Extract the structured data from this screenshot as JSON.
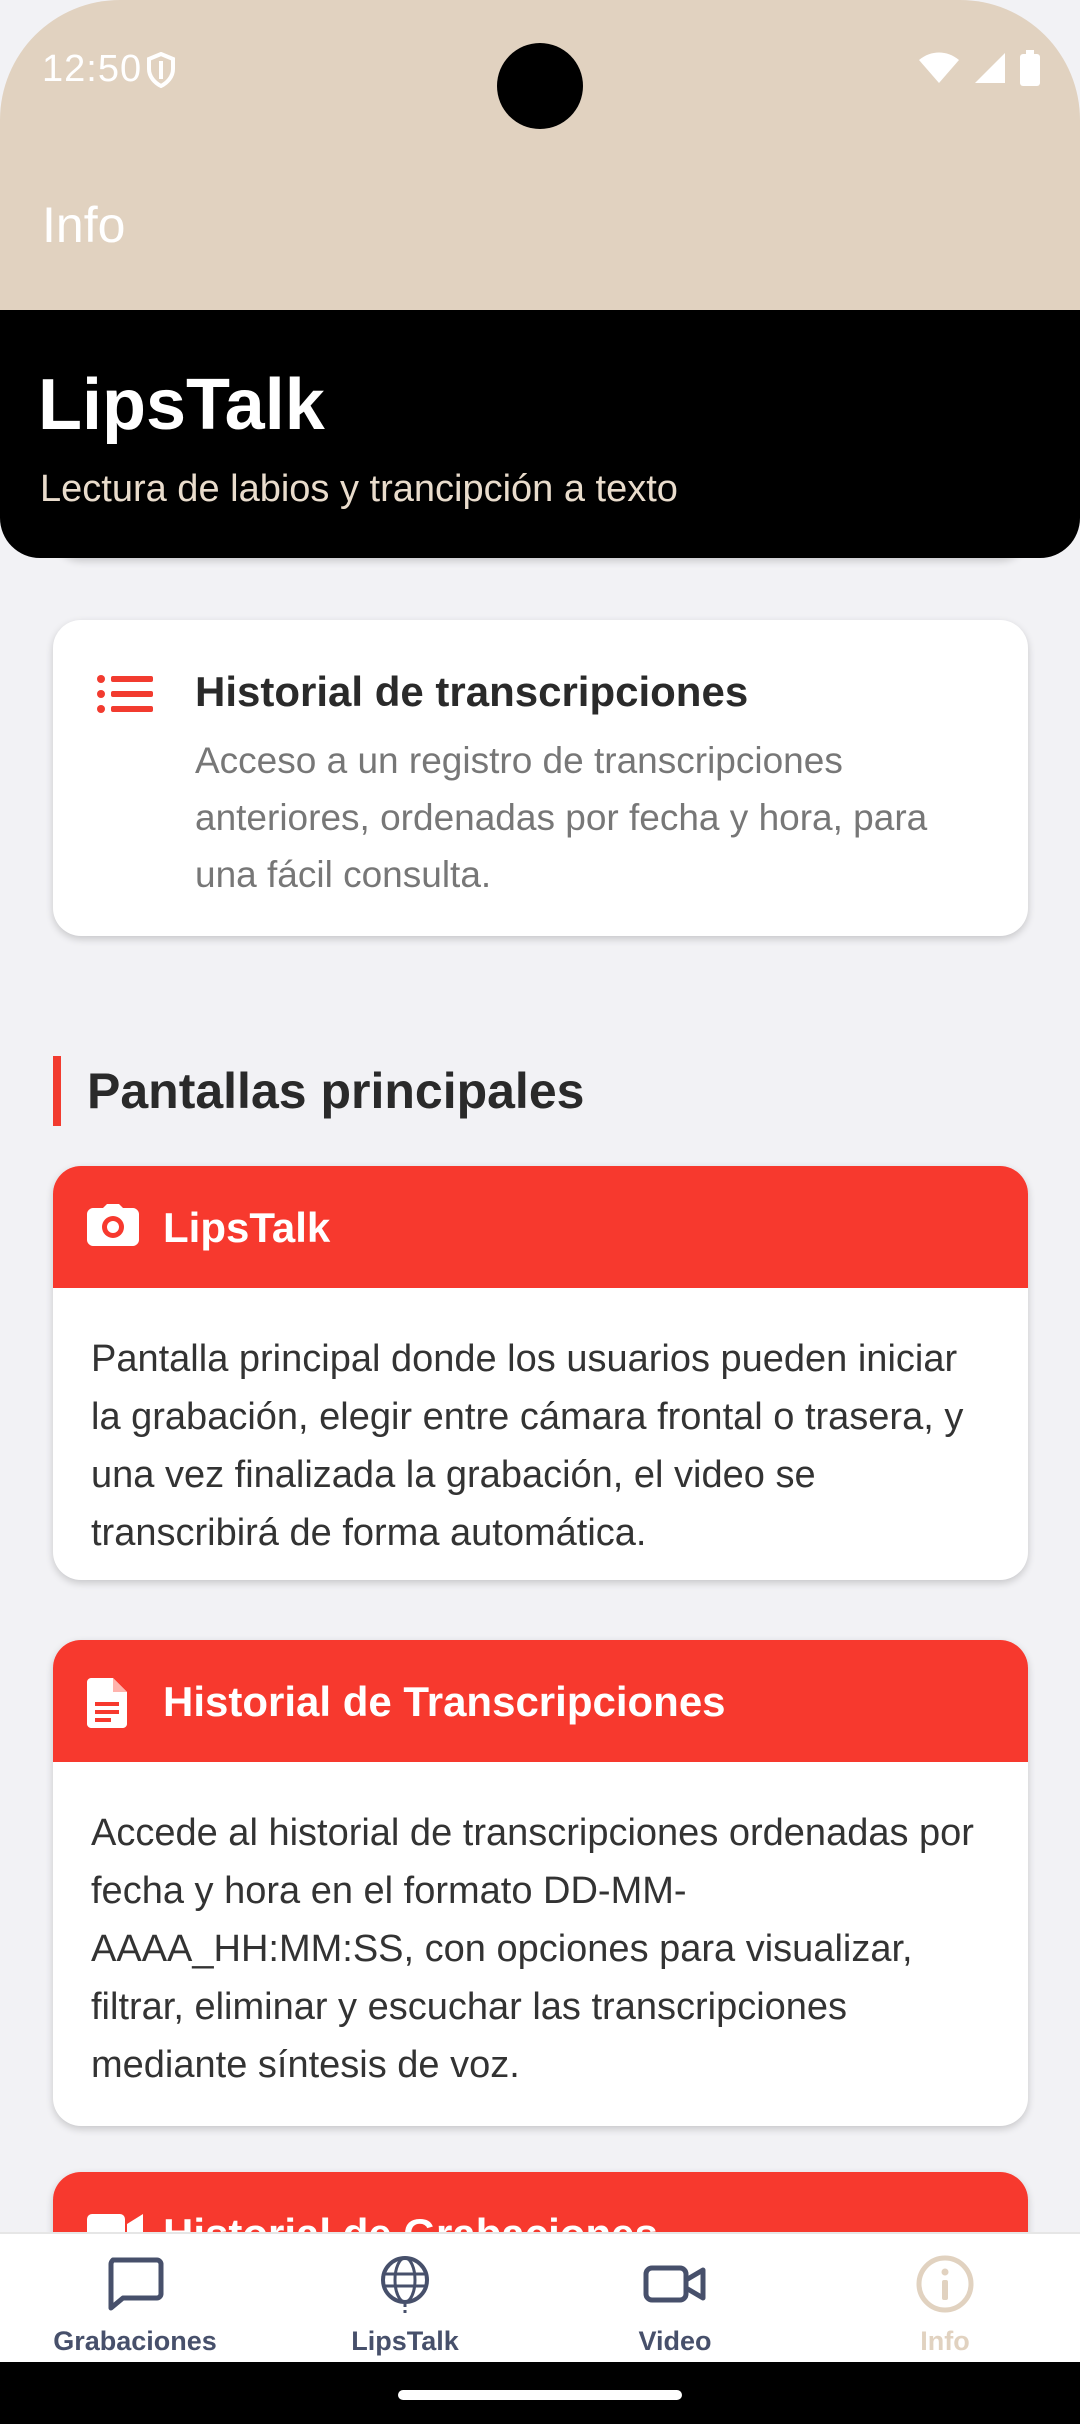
{
  "status_bar": {
    "time": "12:50"
  },
  "app_bar": {
    "title": "Info"
  },
  "hero": {
    "title": "LipsTalk",
    "subtitle": "Lectura de labios y trancipción a texto"
  },
  "feature": {
    "title": "Historial de transcripciones",
    "description": "Acceso a un registro de transcripciones anteriores, ordenadas por fecha y hora, para una fácil consulta."
  },
  "section": {
    "title": "Pantallas principales"
  },
  "screens": [
    {
      "icon": "camera-icon",
      "title": "LipsTalk",
      "description": "Pantalla principal donde los usuarios pueden iniciar la grabación, elegir entre cámara frontal o trasera, y una vez finalizada la grabación, el video se transcribirá de forma automática."
    },
    {
      "icon": "document-icon",
      "title": "Historial de Transcripciones",
      "description": "Accede al historial de transcripciones ordenadas por fecha y hora en el formato DD-MM-AAAA_HH:MM:SS, con opciones para visualizar, filtrar, eliminar y escuchar las transcripciones mediante síntesis de voz."
    },
    {
      "icon": "video-icon",
      "title": "Historial de Grabaciones",
      "description": ""
    }
  ],
  "bottom_nav": {
    "items": [
      {
        "label": "Grabaciones",
        "icon": "chat-bubble-icon"
      },
      {
        "label": "LipsTalk",
        "icon": "globe-icon"
      },
      {
        "label": "Video",
        "icon": "video-camera-icon"
      },
      {
        "label": "Info",
        "icon": "info-icon"
      }
    ],
    "active": "Info"
  },
  "colors": {
    "accent": "#f7392e",
    "header": "#e1d2c0",
    "hero": "#000000"
  }
}
